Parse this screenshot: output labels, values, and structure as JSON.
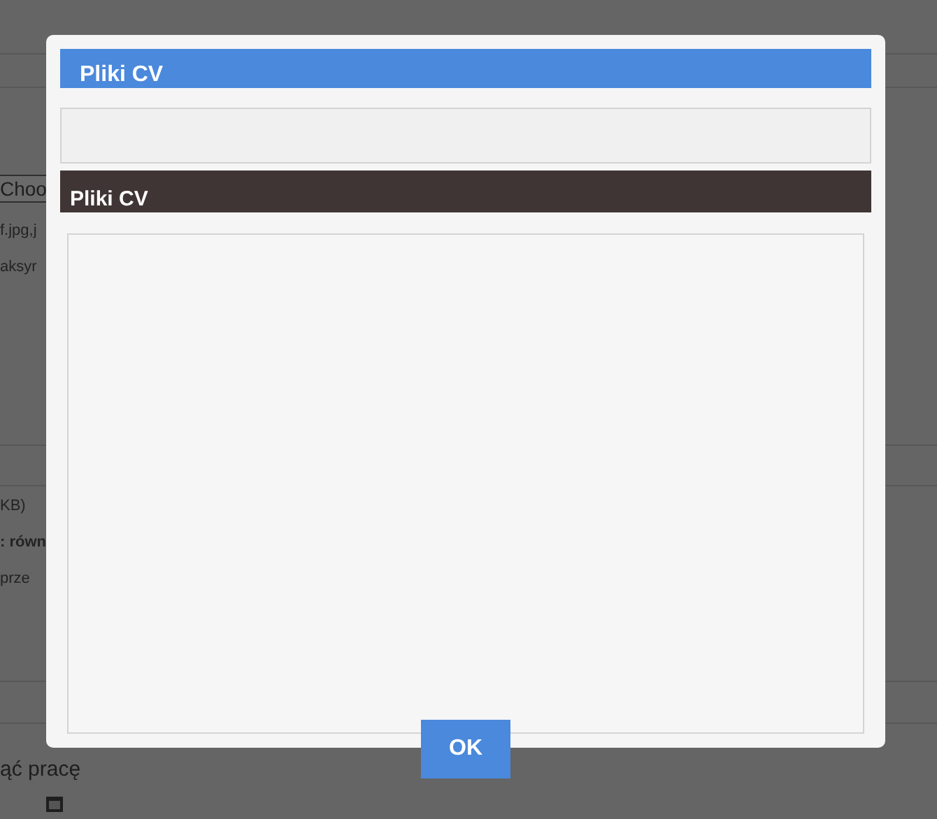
{
  "background": {
    "upper": [
      {
        "kind": "button",
        "text": "Choo"
      },
      {
        "kind": "text",
        "text": "f.jpg,j"
      },
      {
        "kind": "text",
        "text": "aksyr"
      }
    ],
    "lower": [
      {
        "kind": "text",
        "text": "KB)"
      },
      {
        "kind": "bold",
        "text": ": równ"
      },
      {
        "kind": "text",
        "text": "prze"
      }
    ],
    "footer_text": "ąć pracę"
  },
  "modal": {
    "title": "Pliki CV",
    "section_title": "Pliki CV",
    "ok_button": "OK"
  }
}
